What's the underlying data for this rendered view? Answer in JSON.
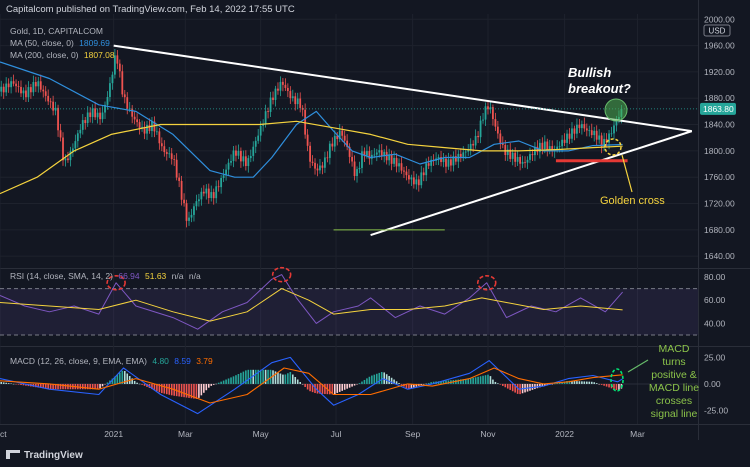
{
  "header": {
    "publisher_line": "Capitalcom published on TradingView.com, Feb 14, 2022 17:55 UTC"
  },
  "legends": {
    "symbol": "Gold, 1D, CAPITALCOM",
    "ma50": {
      "label": "MA (50, close, 0)",
      "value": "1809.69",
      "color": "#2f8fdd"
    },
    "ma200": {
      "label": "MA (200, close, 0)",
      "value": "1807.08",
      "color": "#f5d33e"
    },
    "rsi": {
      "label": "RSI (14, close, SMA, 14, 2)",
      "v1": "66.94",
      "v2": "51.63",
      "v3": "n/a",
      "v4": "n/a"
    },
    "macd": {
      "label": "MACD (12, 26, close, 9, EMA, EMA)",
      "v1": "4.80",
      "v2": "8.59",
      "v3": "3.79"
    }
  },
  "annotations": {
    "bullish": "Bullish breakout?",
    "golden": "Golden cross",
    "macd_note": "MACD turns positive & MACD line crosses signal line"
  },
  "price_labels": {
    "usd": "USD",
    "last": "1863.80"
  },
  "branding": {
    "logo_text": "TradingView"
  },
  "chart_data": [
    {
      "type": "line",
      "panel": "price",
      "title": "Gold, 1D, CAPITALCOM",
      "ylabel": "USD",
      "ylim": [
        1622,
        2008
      ],
      "y_ticks": [
        2000,
        1960,
        1920,
        1880,
        1840,
        1800,
        1760,
        1720,
        1680,
        1640
      ],
      "x_ticks": [
        "Oct",
        "2021",
        "Mar",
        "May",
        "Jul",
        "Sep",
        "Nov",
        "2022",
        "Mar"
      ],
      "x_tick_days": [
        0,
        92,
        150,
        211,
        272,
        334,
        395,
        457,
        516
      ],
      "xlim": [
        0,
        565
      ],
      "x_unit": "days from Oct 1, 2020",
      "series": [
        {
          "name": "Gold close",
          "color": "#26a69a",
          "points": [
            [
              0,
              1890
            ],
            [
              10,
              1905
            ],
            [
              20,
              1885
            ],
            [
              30,
              1905
            ],
            [
              38,
              1880
            ],
            [
              45,
              1860
            ],
            [
              52,
              1780
            ],
            [
              58,
              1800
            ],
            [
              66,
              1840
            ],
            [
              74,
              1860
            ],
            [
              82,
              1850
            ],
            [
              88,
              1890
            ],
            [
              94,
              1950
            ],
            [
              100,
              1880
            ],
            [
              108,
              1850
            ],
            [
              116,
              1830
            ],
            [
              124,
              1840
            ],
            [
              132,
              1800
            ],
            [
              140,
              1790
            ],
            [
              146,
              1740
            ],
            [
              152,
              1690
            ],
            [
              158,
              1720
            ],
            [
              165,
              1740
            ],
            [
              172,
              1730
            ],
            [
              180,
              1760
            ],
            [
              190,
              1800
            ],
            [
              200,
              1780
            ],
            [
              210,
              1830
            ],
            [
              220,
              1880
            ],
            [
              228,
              1905
            ],
            [
              236,
              1880
            ],
            [
              244,
              1870
            ],
            [
              250,
              1790
            ],
            [
              256,
              1770
            ],
            [
              262,
              1780
            ],
            [
              268,
              1810
            ],
            [
              276,
              1830
            ],
            [
              282,
              1800
            ],
            [
              288,
              1760
            ],
            [
              294,
              1800
            ],
            [
              300,
              1790
            ],
            [
              306,
              1800
            ],
            [
              314,
              1790
            ],
            [
              322,
              1780
            ],
            [
              330,
              1760
            ],
            [
              338,
              1750
            ],
            [
              346,
              1780
            ],
            [
              354,
              1790
            ],
            [
              362,
              1780
            ],
            [
              370,
              1790
            ],
            [
              378,
              1800
            ],
            [
              386,
              1820
            ],
            [
              392,
              1860
            ],
            [
              396,
              1870
            ],
            [
              402,
              1830
            ],
            [
              408,
              1800
            ],
            [
              416,
              1790
            ],
            [
              424,
              1780
            ],
            [
              432,
              1800
            ],
            [
              440,
              1810
            ],
            [
              448,
              1800
            ],
            [
              456,
              1815
            ],
            [
              464,
              1830
            ],
            [
              470,
              1840
            ],
            [
              476,
              1830
            ],
            [
              482,
              1825
            ],
            [
              488,
              1810
            ],
            [
              494,
              1825
            ],
            [
              500,
              1850
            ],
            [
              504,
              1863.8
            ]
          ]
        },
        {
          "name": "MA (50, close, 0)",
          "color": "#2f8fdd",
          "points": [
            [
              0,
              1935
            ],
            [
              40,
              1910
            ],
            [
              80,
              1870
            ],
            [
              110,
              1860
            ],
            [
              140,
              1825
            ],
            [
              170,
              1770
            ],
            [
              190,
              1760
            ],
            [
              205,
              1760
            ],
            [
              220,
              1790
            ],
            [
              240,
              1840
            ],
            [
              256,
              1860
            ],
            [
              270,
              1830
            ],
            [
              285,
              1800
            ],
            [
              300,
              1790
            ],
            [
              320,
              1795
            ],
            [
              340,
              1780
            ],
            [
              360,
              1790
            ],
            [
              380,
              1790
            ],
            [
              400,
              1810
            ],
            [
              420,
              1815
            ],
            [
              440,
              1800
            ],
            [
              460,
              1800
            ],
            [
              480,
              1808
            ],
            [
              504,
              1809.69
            ]
          ]
        },
        {
          "name": "MA (200, close, 0)",
          "color": "#f5d33e",
          "points": [
            [
              0,
              1735
            ],
            [
              30,
              1760
            ],
            [
              60,
              1800
            ],
            [
              90,
              1825
            ],
            [
              130,
              1840
            ],
            [
              170,
              1840
            ],
            [
              210,
              1840
            ],
            [
              240,
              1845
            ],
            [
              270,
              1835
            ],
            [
              300,
              1825
            ],
            [
              330,
              1810
            ],
            [
              360,
              1805
            ],
            [
              390,
              1800
            ],
            [
              420,
              1800
            ],
            [
              450,
              1802
            ],
            [
              480,
              1805
            ],
            [
              504,
              1807.08
            ]
          ]
        }
      ],
      "trendlines": [
        {
          "name": "upper",
          "from": [
            92,
            1960
          ],
          "to": [
            560,
            1830
          ]
        },
        {
          "name": "lower",
          "from": [
            300,
            1672
          ],
          "to": [
            560,
            1830
          ]
        },
        {
          "name": "support",
          "from": [
            270,
            1680
          ],
          "to": [
            360,
            1680
          ]
        }
      ],
      "support_zone": {
        "from_day": 450,
        "to_day": 508,
        "value": 1785
      }
    },
    {
      "type": "line",
      "panel": "rsi",
      "title": "RSI (14, close, SMA, 14, 2)",
      "ylim": [
        24,
        86
      ],
      "y_ticks": [
        80,
        60,
        40
      ],
      "bands": [
        70,
        30
      ],
      "series": [
        {
          "name": "RSI",
          "color": "#7e57c2",
          "points": [
            [
              0,
              64
            ],
            [
              20,
              55
            ],
            [
              40,
              50
            ],
            [
              60,
              55
            ],
            [
              80,
              48
            ],
            [
              94,
              75
            ],
            [
              110,
              55
            ],
            [
              140,
              45
            ],
            [
              160,
              35
            ],
            [
              180,
              50
            ],
            [
              200,
              58
            ],
            [
              220,
              78
            ],
            [
              228,
              82
            ],
            [
              240,
              62
            ],
            [
              256,
              40
            ],
            [
              270,
              50
            ],
            [
              290,
              55
            ],
            [
              300,
              62
            ],
            [
              320,
              45
            ],
            [
              340,
              55
            ],
            [
              360,
              48
            ],
            [
              380,
              62
            ],
            [
              394,
              75
            ],
            [
              410,
              45
            ],
            [
              430,
              55
            ],
            [
              450,
              50
            ],
            [
              470,
              62
            ],
            [
              490,
              50
            ],
            [
              504,
              66.94
            ]
          ]
        },
        {
          "name": "RSI SMA",
          "color": "#f5d33e",
          "points": [
            [
              0,
              58
            ],
            [
              40,
              55
            ],
            [
              80,
              52
            ],
            [
              110,
              60
            ],
            [
              140,
              50
            ],
            [
              170,
              42
            ],
            [
              200,
              50
            ],
            [
              228,
              70
            ],
            [
              250,
              60
            ],
            [
              270,
              48
            ],
            [
              300,
              52
            ],
            [
              330,
              52
            ],
            [
              360,
              55
            ],
            [
              390,
              62
            ],
            [
              410,
              58
            ],
            [
              440,
              52
            ],
            [
              470,
              55
            ],
            [
              504,
              51.63
            ]
          ]
        }
      ]
    },
    {
      "type": "bar",
      "panel": "macd",
      "title": "MACD (12, 26, close, 9, EMA, EMA)",
      "ylim": [
        -34,
        32
      ],
      "y_ticks": [
        25,
        0,
        -25
      ],
      "series": [
        {
          "name": "MACD",
          "color": "#2962ff",
          "points": [
            [
              0,
              5
            ],
            [
              40,
              -5
            ],
            [
              80,
              -10
            ],
            [
              100,
              15
            ],
            [
              130,
              -10
            ],
            [
              160,
              -28
            ],
            [
              190,
              -5
            ],
            [
              220,
              20
            ],
            [
              235,
              25
            ],
            [
              256,
              -5
            ],
            [
              270,
              -20
            ],
            [
              290,
              -10
            ],
            [
              310,
              5
            ],
            [
              330,
              -5
            ],
            [
              350,
              0
            ],
            [
              380,
              10
            ],
            [
              396,
              22
            ],
            [
              420,
              -5
            ],
            [
              440,
              -2
            ],
            [
              460,
              5
            ],
            [
              480,
              8
            ],
            [
              500,
              2
            ],
            [
              504,
              4.8
            ]
          ]
        },
        {
          "name": "Signal",
          "color": "#ff6d00",
          "points": [
            [
              0,
              3
            ],
            [
              40,
              0
            ],
            [
              80,
              -5
            ],
            [
              110,
              5
            ],
            [
              140,
              -5
            ],
            [
              170,
              -18
            ],
            [
              200,
              -10
            ],
            [
              230,
              15
            ],
            [
              250,
              10
            ],
            [
              270,
              -10
            ],
            [
              300,
              -10
            ],
            [
              330,
              0
            ],
            [
              350,
              -2
            ],
            [
              380,
              5
            ],
            [
              400,
              15
            ],
            [
              420,
              5
            ],
            [
              440,
              0
            ],
            [
              460,
              2
            ],
            [
              480,
              6
            ],
            [
              504,
              8.59
            ]
          ]
        }
      ]
    }
  ]
}
